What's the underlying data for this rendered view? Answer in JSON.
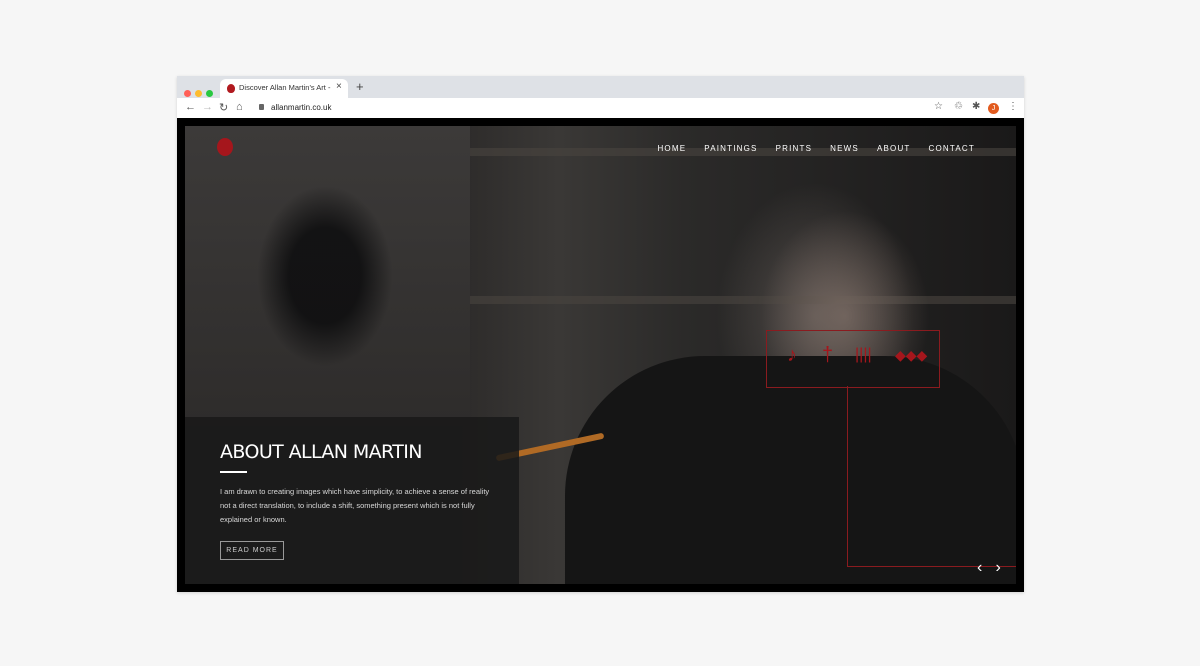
{
  "browser": {
    "tab_title": "Discover Allan Martin's Art - S...",
    "url": "allanmartin.co.uk",
    "avatar_initial": "J",
    "colors": {
      "close": "#ff5f57",
      "minimize": "#febc2e",
      "maximize": "#28c840"
    }
  },
  "site": {
    "nav": [
      "HOME",
      "PAINTINGS",
      "PRINTS",
      "NEWS",
      "ABOUT",
      "CONTACT"
    ],
    "accent": "#a5161c",
    "about": {
      "title": "ABOUT ALLAN MARTIN",
      "body": "I am drawn to creating images which have simplicity, to achieve a sense of reality not a direct translation, to include a shift, something present which is not fully explained or known.",
      "button": "READ MORE"
    }
  }
}
